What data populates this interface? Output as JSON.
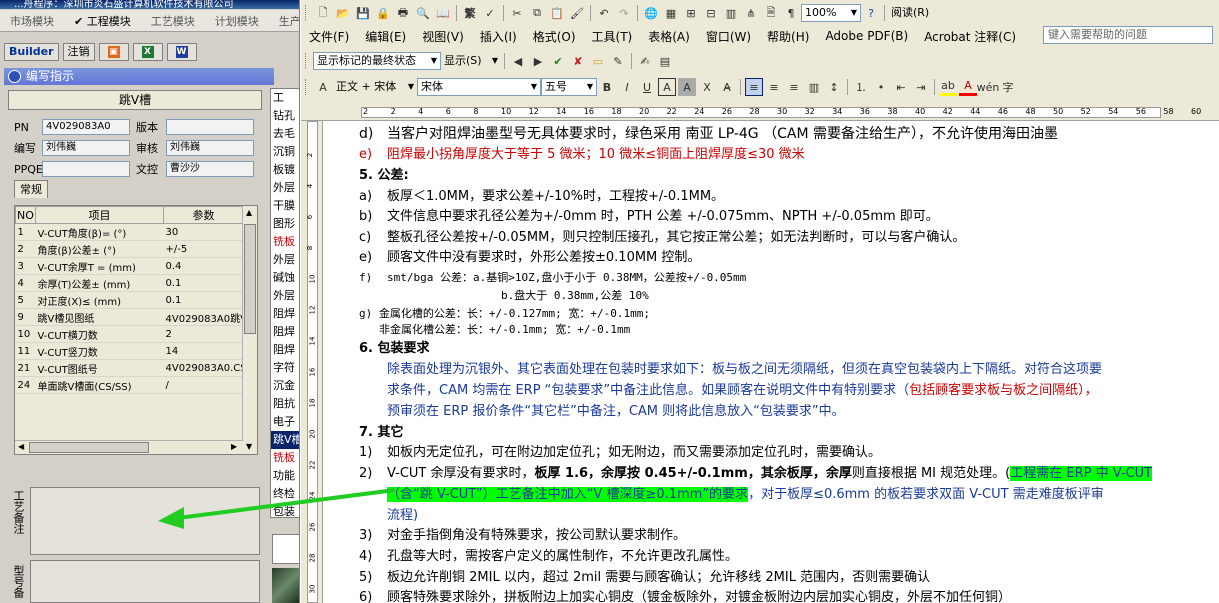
{
  "left_app": {
    "title": "...舟程序：深圳市炎石盛计算机软件技术有限公司",
    "modules": [
      {
        "label": "市场模块",
        "active": false
      },
      {
        "label": "✔ 工程模块",
        "active": true
      },
      {
        "label": "工艺模块",
        "active": false
      },
      {
        "label": "计划模块",
        "active": false
      },
      {
        "label": "生产模",
        "active": false
      }
    ],
    "toolbar": {
      "builder": "Builder",
      "logout": "注销"
    },
    "panel_title": "编写指示",
    "form_heading": "跳V槽",
    "fields": {
      "pn_label": "PN",
      "pn_value": "4V029083A0",
      "version_label": "版本",
      "version_value": "",
      "writer_label": "编写",
      "writer_value": "刘伟巍",
      "reviewer_label": "审核",
      "reviewer_value": "刘伟巍",
      "ppqe_label": "PPQE",
      "ppqe_value": "",
      "control_label": "文控",
      "control_value": "曹沙沙"
    },
    "tab": "常规",
    "table_headers": [
      "NO",
      "项目",
      "参数"
    ],
    "table_rows": [
      [
        "1",
        "V-CUT角度(β)=  (°)",
        "30"
      ],
      [
        "2",
        "角度(β)公差±  (°)",
        "+/-5"
      ],
      [
        "3",
        "V-CUT余厚T =  (mm)",
        "0.4"
      ],
      [
        "4",
        "余厚(T)公差±   (mm)",
        "0.1"
      ],
      [
        "5",
        "对正度(X)≤ (mm)",
        "0.1"
      ],
      [
        "9",
        "跳V槽见图纸",
        "4V029083A0跳V"
      ],
      [
        "10",
        "V-CUT横刀数",
        "2"
      ],
      [
        "11",
        "V-CUT竖刀数",
        "14"
      ],
      [
        "21",
        "V-CUT图纸号",
        "4V029083A0.CS"
      ],
      [
        "24",
        "单面跳V槽面(CS/SS)",
        "/"
      ]
    ],
    "memo_label": "工艺备注",
    "memo2_label": "型号备",
    "side_list": [
      {
        "t": "工",
        "c": ""
      },
      {
        "t": "钻孔",
        "c": ""
      },
      {
        "t": "去毛",
        "c": ""
      },
      {
        "t": "沉铜",
        "c": ""
      },
      {
        "t": "板镀",
        "c": ""
      },
      {
        "t": "外层",
        "c": ""
      },
      {
        "t": "干膜",
        "c": ""
      },
      {
        "t": "图形",
        "c": ""
      },
      {
        "t": "铣板",
        "c": "red"
      },
      {
        "t": "外层",
        "c": ""
      },
      {
        "t": "碱蚀",
        "c": ""
      },
      {
        "t": "外层",
        "c": ""
      },
      {
        "t": "阻焊",
        "c": ""
      },
      {
        "t": "阻焊",
        "c": ""
      },
      {
        "t": "阻焊",
        "c": ""
      },
      {
        "t": "字符",
        "c": ""
      },
      {
        "t": "沉金",
        "c": ""
      },
      {
        "t": "阻抗",
        "c": ""
      },
      {
        "t": "电子",
        "c": ""
      },
      {
        "t": "跳V槽",
        "c": "sel"
      },
      {
        "t": "铣板",
        "c": "red"
      },
      {
        "t": "功能",
        "c": ""
      },
      {
        "t": "终检",
        "c": ""
      },
      {
        "t": "包装",
        "c": ""
      },
      {
        "t": "成品",
        "c": ""
      }
    ]
  },
  "word": {
    "menu": [
      "文件(F)",
      "编辑(E)",
      "视图(V)",
      "插入(I)",
      "格式(O)",
      "工具(T)",
      "表格(A)",
      "窗口(W)",
      "帮助(H)",
      "Adobe PDF(B)",
      "Acrobat 注释(C)"
    ],
    "help_placeholder": "键入需要帮助的问题",
    "zoom": "100%",
    "read_btn": "阅读(R)",
    "markup_mode": "显示标记的最终状态",
    "show_btn": "显示(S)",
    "style": "正文 + 宋体",
    "font": "宋体",
    "size": "五号",
    "ruler_ticks": [
      "2",
      "2",
      "4",
      "6",
      "8",
      "10",
      "12",
      "14",
      "16",
      "18",
      "20",
      "22",
      "24",
      "26",
      "28",
      "30",
      "32",
      "34",
      "36",
      "38",
      "40",
      "42",
      "44",
      "46",
      "48",
      "50",
      "52",
      "54",
      "56",
      "58",
      "60"
    ],
    "vruler_ticks": [
      "2",
      "4",
      "6",
      "8",
      "10",
      "12",
      "14",
      "16",
      "18",
      "20",
      "22",
      "24",
      "26",
      "28",
      "30"
    ],
    "lines": {
      "d": "d)",
      "d_text": "当客户对阻焊油墨型号无具体要求时，绿色采用 南亚 LP-4G （CAM 需要备注给生产），不允许使用海田油墨",
      "e": "e)",
      "e_text": "阻焊最小拐角厚度大于等于 5 微米；10 微米≤铜面上阻焊厚度≤30 微米",
      "h5": "5.   公差:",
      "a": "a)",
      "a_text": "板厚＜1.0MM，要求公差+/-10%时，工程按+/-0.1MM。",
      "b": "b)",
      "b_text": "文件信息中要求孔径公差为+/-0mm 时，PTH 公差  +/-0.075mm、NPTH +/-0.05mm 即可。",
      "c": "c)",
      "c_text": "整板孔径公差按+/-0.05MM，则只控制压接孔，其它按正常公差；如无法判断时，可以与客户确认。",
      "e2": "e)",
      "e2_text": "顾客文件中没有要求时，外形公差按±0.10MM 控制。",
      "f": "f)",
      "f_text": "smt/bga 公差：a.基铜>1OZ,盘小于小于 0.38MM，公差按+/-0.05mm",
      "f2_text": "b.盘大于 0.38mm,公差 10%",
      "g_text": "g) 金属化槽的公差：长：+/-0.127mm; 宽：+/-0.1mm;",
      "g2_text": "非金属化槽公差：长：+/-0.1mm; 宽：+/-0.1mm",
      "h6": "6.   包装要求",
      "p6a": "除表面处理为沉银外、其它表面处理在包装时要求如下：板与板之间无须隔纸，但须在真空包装袋内上下隔纸。对符合这项要",
      "p6b": "求条件，CAM 均需在 ERP “包装要求”中备注此信息。如果顾客在说明文件中有特别要求（",
      "p6b_red": "包括顾客要求板与板之间隔纸），",
      "p6c": "预审须在 ERP 报价条件“其它栏”中备注，CAM 则将此信息放入“包装要求”中。",
      "h7": "7.   其它",
      "o1": "1)",
      "o1_text": "如板内无定位孔，可在附边加定位孔；如无附边，而又需要添加定位孔时，需要确认。",
      "o2": "2)",
      "o2_a": "V-CUT 余厚没有要求时，",
      "o2_b": "板厚 1.6，余厚按 0.45+/-0.1mm，其余板厚，余厚",
      "o2_c": "则直接根据 MI 规范处理。(",
      "o2_hl1": "工程需在 ERP 中 V-CUT",
      "o2_hl2": "（含“跳 V-CUT”）工艺备注中加入“V 槽深度≥0.1mm”的要求",
      "o2_d": "，对于板厚≤0.6mm 的板若要求双面 V-CUT 需走难度板评审",
      "o2_e": "流程)",
      "o3": "3)",
      "o3_text": "对金手指倒角没有特殊要求，按公司默认要求制作。",
      "o4": "4)",
      "o4_text": "孔盘等大时，需按客户定义的属性制作，不允许更改孔属性。",
      "o5": "5)",
      "o5_text": "板边允许削铜 2MIL 以内，超过 2mil 需要与顾客确认；允许移线 2MIL 范围内，否则需要确认",
      "o6": "6)",
      "o6_text": "顾客特殊要求除外，拼板附边上加实心铜皮（镀金板除外，对镀金板附边内层加实心铜皮，外层不加任何铜）"
    }
  },
  "colors": {
    "highlight": "#00ff00",
    "arrow": "#22cc22",
    "red_text": "#cc0000",
    "blue_text": "#1a3a9a"
  }
}
